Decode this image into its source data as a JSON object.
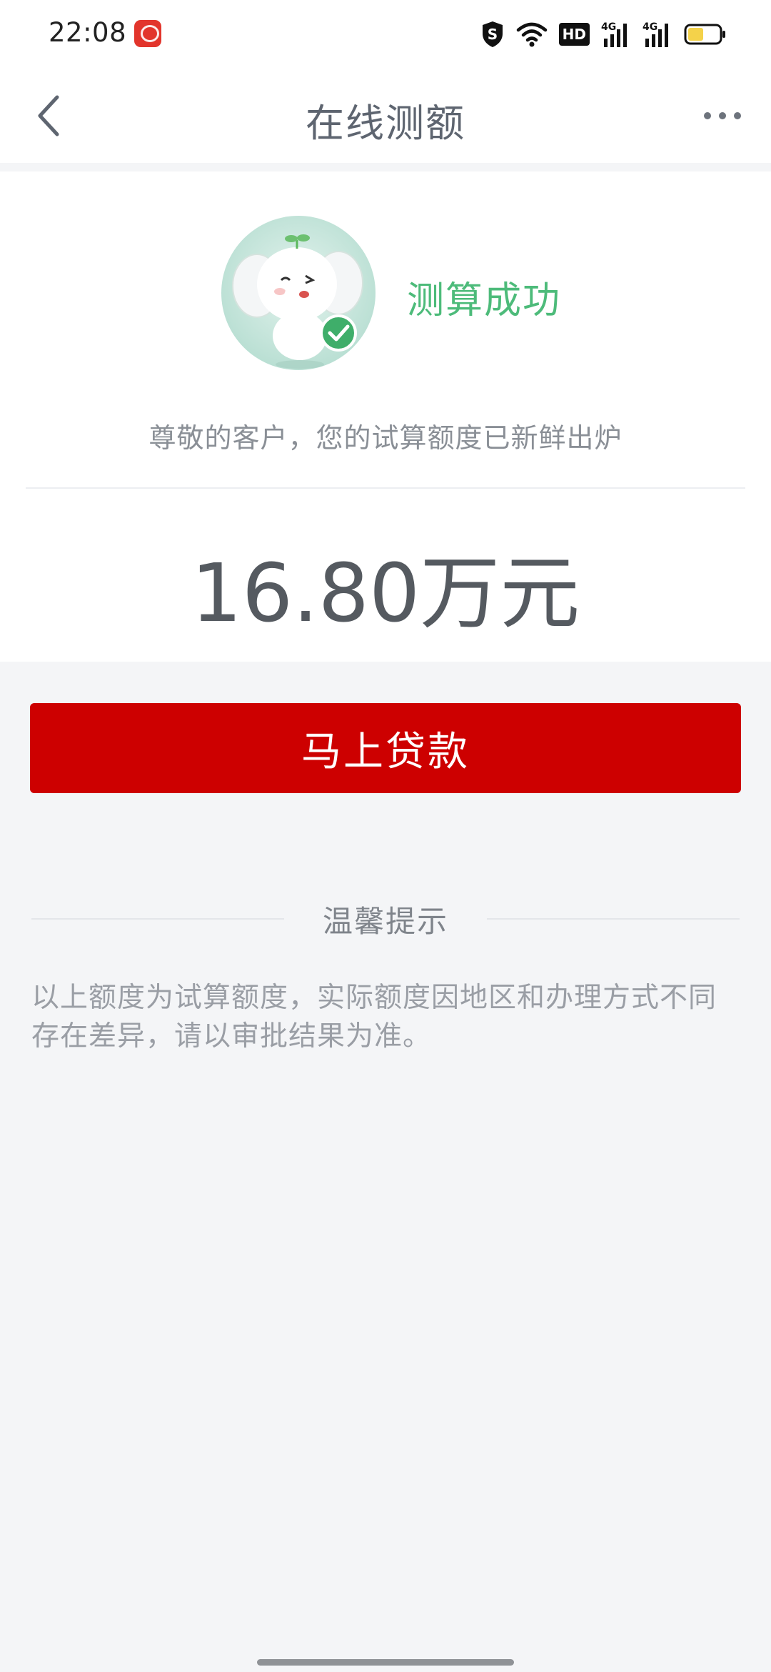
{
  "status_bar": {
    "time": "22:08",
    "network_1": "4G",
    "network_2": "4G",
    "hd_label": "HD",
    "icons": [
      "app-badge-icon",
      "shield-s-icon",
      "wifi-icon",
      "hd-icon",
      "signal-4g-icon",
      "signal-4g-icon",
      "battery-icon"
    ],
    "battery_level": 0.5,
    "battery_color": "#f4d24a"
  },
  "nav": {
    "title": "在线测额",
    "back_icon": "chevron-left-icon",
    "more_icon": "more-dots-icon"
  },
  "result": {
    "mascot_icon": "elephant-mascot-icon",
    "status": "测算成功",
    "status_color": "#4dbb7a",
    "message": "尊敬的客户，您的试算额度已新鲜出炉",
    "amount": "16.80万元"
  },
  "action": {
    "loan_button_label": "马上贷款",
    "button_color": "#cd0000"
  },
  "tips": {
    "title": "温馨提示",
    "content": "以上额度为试算额度，实际额度因地区和办理方式不同存在差异，请以审批结果为准。"
  }
}
